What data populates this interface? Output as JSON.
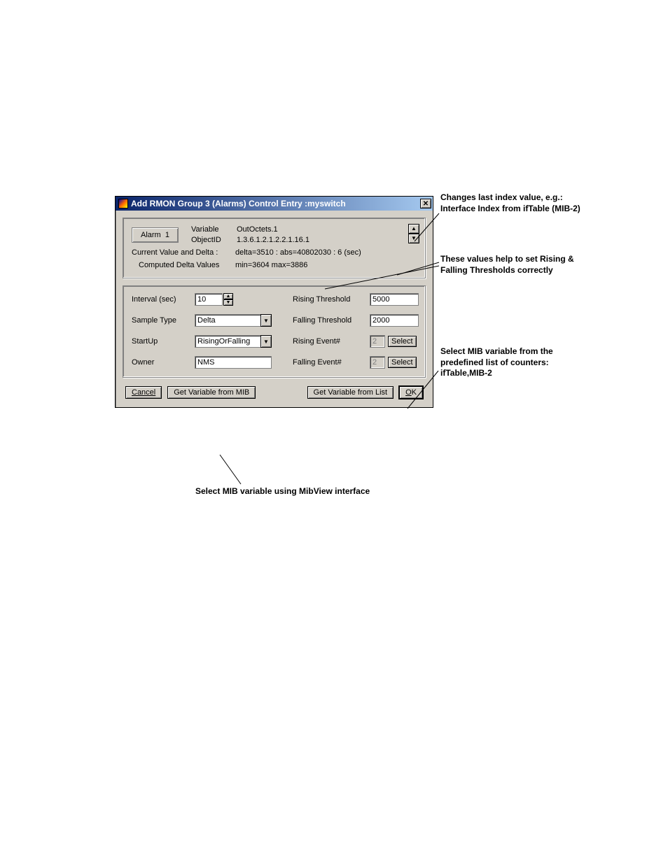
{
  "titlebar": {
    "title": "Add RMON Group 3 (Alarms) Control Entry :myswitch"
  },
  "top": {
    "alarm_label": "Alarm",
    "alarm_value": "1",
    "variable_label": "Variable",
    "variable_value": "OutOctets.1",
    "objectid_label": "ObjectID",
    "objectid_value": "1.3.6.1.2.1.2.2.1.16.1",
    "cvd_label": "Current Value and Delta :",
    "cvd_value": "delta=3510 : abs=40802030 : 6 (sec)",
    "computed_label": "Computed Delta Values",
    "computed_value": "min=3604 max=3886"
  },
  "fields": {
    "interval_label": "Interval (sec)",
    "interval_value": "10",
    "sample_label": "Sample Type",
    "sample_value": "Delta",
    "startup_label": "StartUp",
    "startup_value": "RisingOrFalling",
    "owner_label": "Owner",
    "owner_value": "NMS",
    "rising_thresh_label": "Rising Threshold",
    "rising_thresh_value": "5000",
    "falling_thresh_label": "Falling Threshold",
    "falling_thresh_value": "2000",
    "rising_event_label": "Rising Event#",
    "rising_event_value": "2",
    "falling_event_label": "Falling Event#",
    "falling_event_value": "2",
    "select_btn": "Select"
  },
  "buttons": {
    "cancel": "Cancel",
    "get_mib": "Get Variable from MIB",
    "get_list": "Get Variable from List",
    "ok": "OK"
  },
  "annotations": {
    "a1": "Changes last index value, e.g.: Interface Index from ifTable (MIB-2)",
    "a2": "These values help to set Rising & Falling Thresholds correctly",
    "a3": "Select MIB variable from the predefined list of counters: ifTable,MIB-2",
    "a4": "Select MIB variable using MibView interface"
  }
}
